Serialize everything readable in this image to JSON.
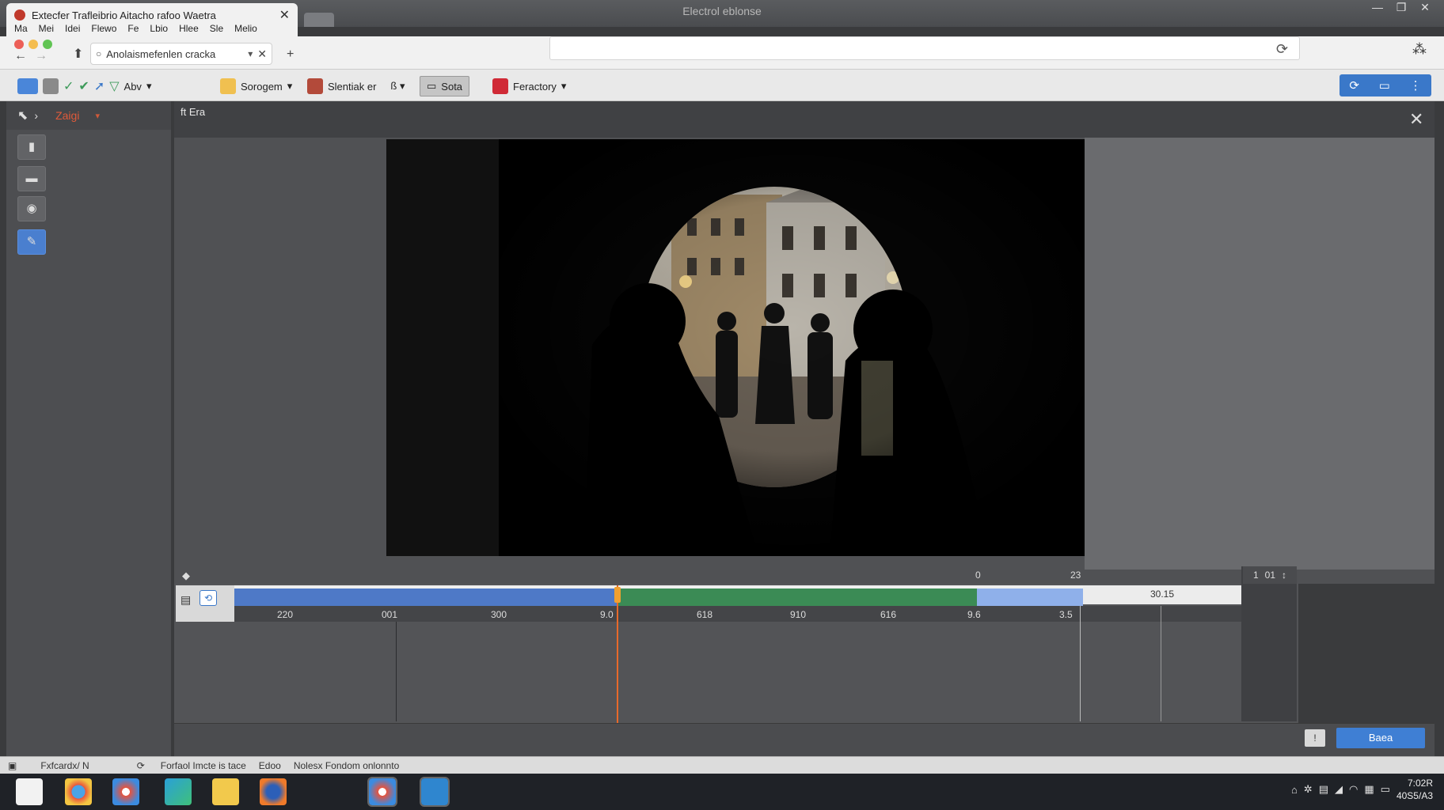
{
  "window": {
    "title": "Electrol eblonse"
  },
  "tab": {
    "title": "Extecfer Trafleibrio Aitacho rafoo Waetra"
  },
  "menu": [
    "Ma",
    "Mei",
    "Idei",
    "Flewo",
    "Fe",
    "Lbio",
    "Hlee",
    "Sle",
    "Melio"
  ],
  "address": {
    "text": "Anolaismefenlen cracka"
  },
  "toolbar": {
    "btn_a_label": "Abv",
    "btn_b_label": "Sorogem",
    "btn_c_label": "Slentiak er",
    "btn_d_label": "Sota",
    "btn_e_label": "Feractory"
  },
  "leftpanel": {
    "header_label": "Zaigi"
  },
  "viewer": {
    "title": "ft Era"
  },
  "timeline": {
    "ticks": [
      "220",
      "001",
      "300",
      "9.0",
      "618",
      "910",
      "616",
      "9.6",
      "3.5"
    ],
    "marker_a": "0",
    "marker_b": "23",
    "end_label": "30.15",
    "zoom": [
      "1",
      "01"
    ]
  },
  "buttons": {
    "ok": "Baea",
    "small": "!"
  },
  "statusbar": {
    "left": "Fxfcardx/ N",
    "mid": "Forfaol Imcte is tace",
    "mid2": "Edoo",
    "right": "Nolesx Fondom onlonnto"
  },
  "clock": {
    "time": "7:02R",
    "date": "40S5/A3"
  },
  "colors": {
    "accent": "#3f7fd4",
    "playhead": "#e8692a",
    "green_clip": "#3b8b55",
    "blue_clip": "#4e79c7"
  }
}
